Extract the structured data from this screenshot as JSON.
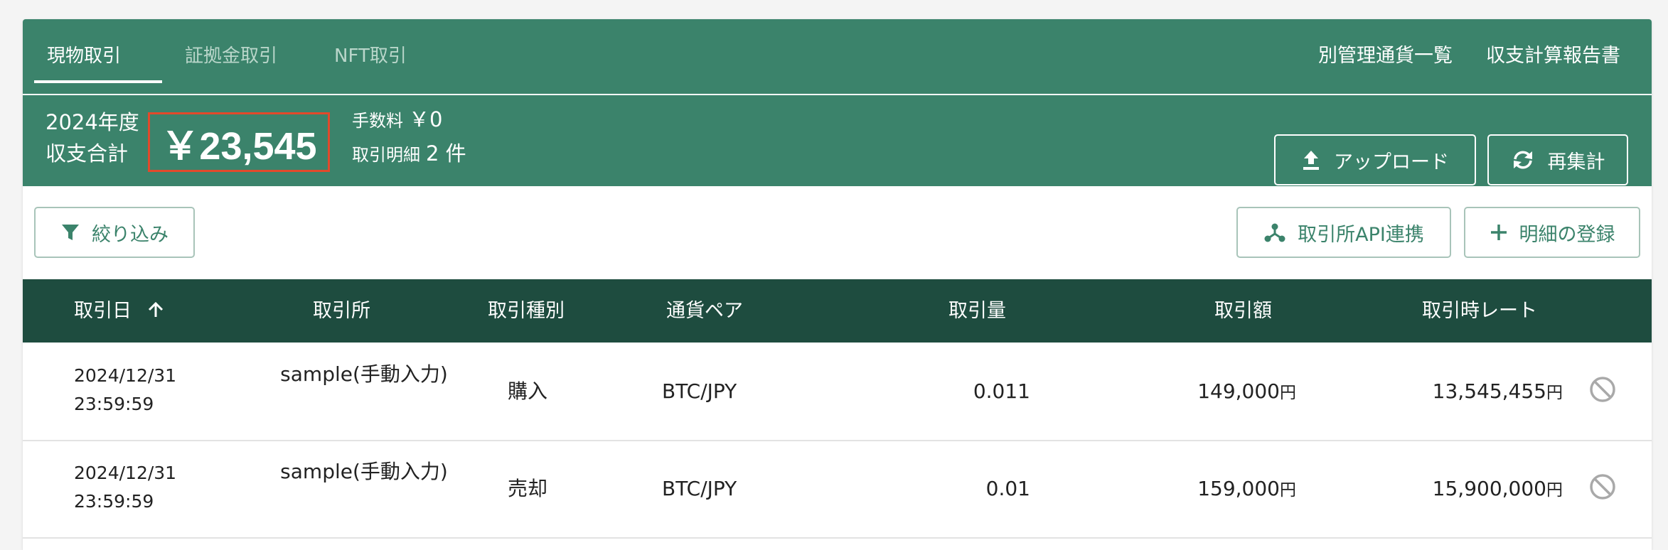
{
  "tabs": [
    {
      "label": "現物取引",
      "active": true
    },
    {
      "label": "証拠金取引",
      "active": false
    },
    {
      "label": "NFT取引",
      "active": false
    }
  ],
  "header_links": {
    "separate_currencies": "別管理通貨一覧",
    "report": "収支計算報告書"
  },
  "summary": {
    "year_label": "2024年度",
    "total_label": "収支合計",
    "total_value": "￥23,545",
    "fee_label": "手数料",
    "fee_value": "￥0",
    "count_label": "取引明細",
    "count_value": "2 件",
    "upload_label": "アップロード",
    "recalc_label": "再集計"
  },
  "toolbar": {
    "filter_label": "絞り込み",
    "api_label": "取引所API連携",
    "add_label": "明細の登録"
  },
  "table": {
    "columns": [
      "取引日",
      "取引所",
      "取引種別",
      "通貨ペア",
      "取引量",
      "取引額",
      "取引時レート"
    ],
    "sort_column": "取引日",
    "sort_direction": "ascending",
    "rows": [
      {
        "date": "2024/12/31",
        "time": "23:59:59",
        "exchange": "sample(手動入力)",
        "type": "購入",
        "pair": "BTC/JPY",
        "amount": "0.011",
        "total": "149,000",
        "rate": "13,545,455",
        "currency_unit": "円"
      },
      {
        "date": "2024/12/31",
        "time": "23:59:59",
        "exchange": "sample(手動入力)",
        "type": "売却",
        "pair": "BTC/JPY",
        "amount": "0.01",
        "total": "159,000",
        "rate": "15,900,000",
        "currency_unit": "円"
      }
    ]
  },
  "colors": {
    "brand_green": "#3b836b",
    "table_header": "#1e4c3f",
    "highlight_border": "#e2492b"
  }
}
